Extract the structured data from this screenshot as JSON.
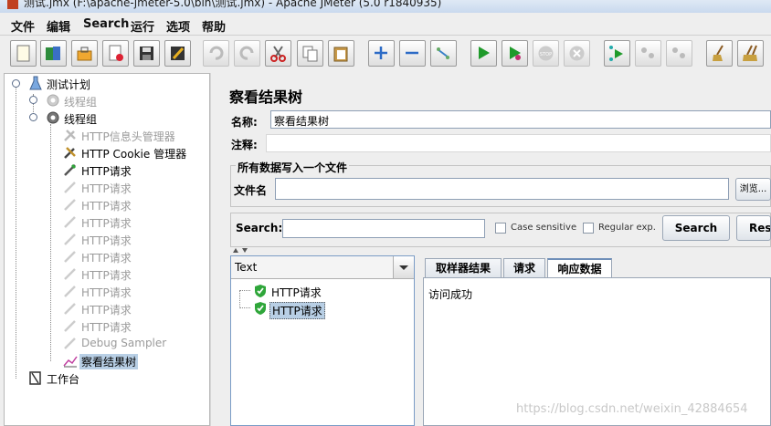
{
  "window": {
    "title": "测试.jmx (F:\\apache-jmeter-5.0\\bin\\测试.jmx) - Apache JMeter (5.0 r1840935)"
  },
  "menu": [
    "文件",
    "编辑",
    "Search",
    "运行",
    "选项",
    "帮助"
  ],
  "toolbar": {
    "icons": [
      "new-icon",
      "templates-icon",
      "open-icon",
      "close-icon",
      "save-icon",
      "save-as-icon",
      "undo-icon",
      "redo-icon",
      "cut-icon",
      "copy-icon",
      "paste-icon",
      "expand-icon",
      "collapse-icon",
      "toggle-icon",
      "start-icon",
      "start-no-pause-icon",
      "stop-icon",
      "shutdown-icon",
      "remote-start-icon",
      "remote-stop-icon",
      "remote-shutdown-icon",
      "clear-icon",
      "clear-all-icon"
    ]
  },
  "tree": {
    "test_plan": "测试计划",
    "thread_group_1": "线程组",
    "thread_group_2": "线程组",
    "header_manager": "HTTP信息头管理器",
    "cookie_manager": "HTTP Cookie 管理器",
    "http_requests": [
      "HTTP请求",
      "HTTP请求",
      "HTTP请求",
      "HTTP请求",
      "HTTP请求",
      "HTTP请求",
      "HTTP请求",
      "HTTP请求",
      "HTTP请求",
      "HTTP请求"
    ],
    "debug_sampler": "Debug Sampler",
    "result_tree": "察看结果树",
    "workbench": "工作台"
  },
  "panel": {
    "title": "察看结果树",
    "name_label": "名称:",
    "name_value": "察看结果树",
    "comment_label": "注释:",
    "comment_value": "",
    "file_group_title": "所有数据写入一个文件",
    "file_label": "文件名",
    "file_value": "",
    "browse_label": "浏览...",
    "search_label": "Search:",
    "search_value": "",
    "case_sensitive": "Case sensitive",
    "regular_exp": "Regular exp.",
    "search_button": "Search",
    "reset_button": "Reset"
  },
  "results": {
    "renderer": "Text",
    "samples": [
      "HTTP请求",
      "HTTP请求"
    ],
    "tabs": [
      "取样器结果",
      "请求",
      "响应数据"
    ],
    "active_tab": "响应数据",
    "response_text": "访问成功"
  },
  "watermark": "https://blog.csdn.net/weixin_42884654",
  "colors": {
    "selection": "#b8cfe5",
    "success": "#2fa63a",
    "disabled_text": "#9b9b9b"
  }
}
